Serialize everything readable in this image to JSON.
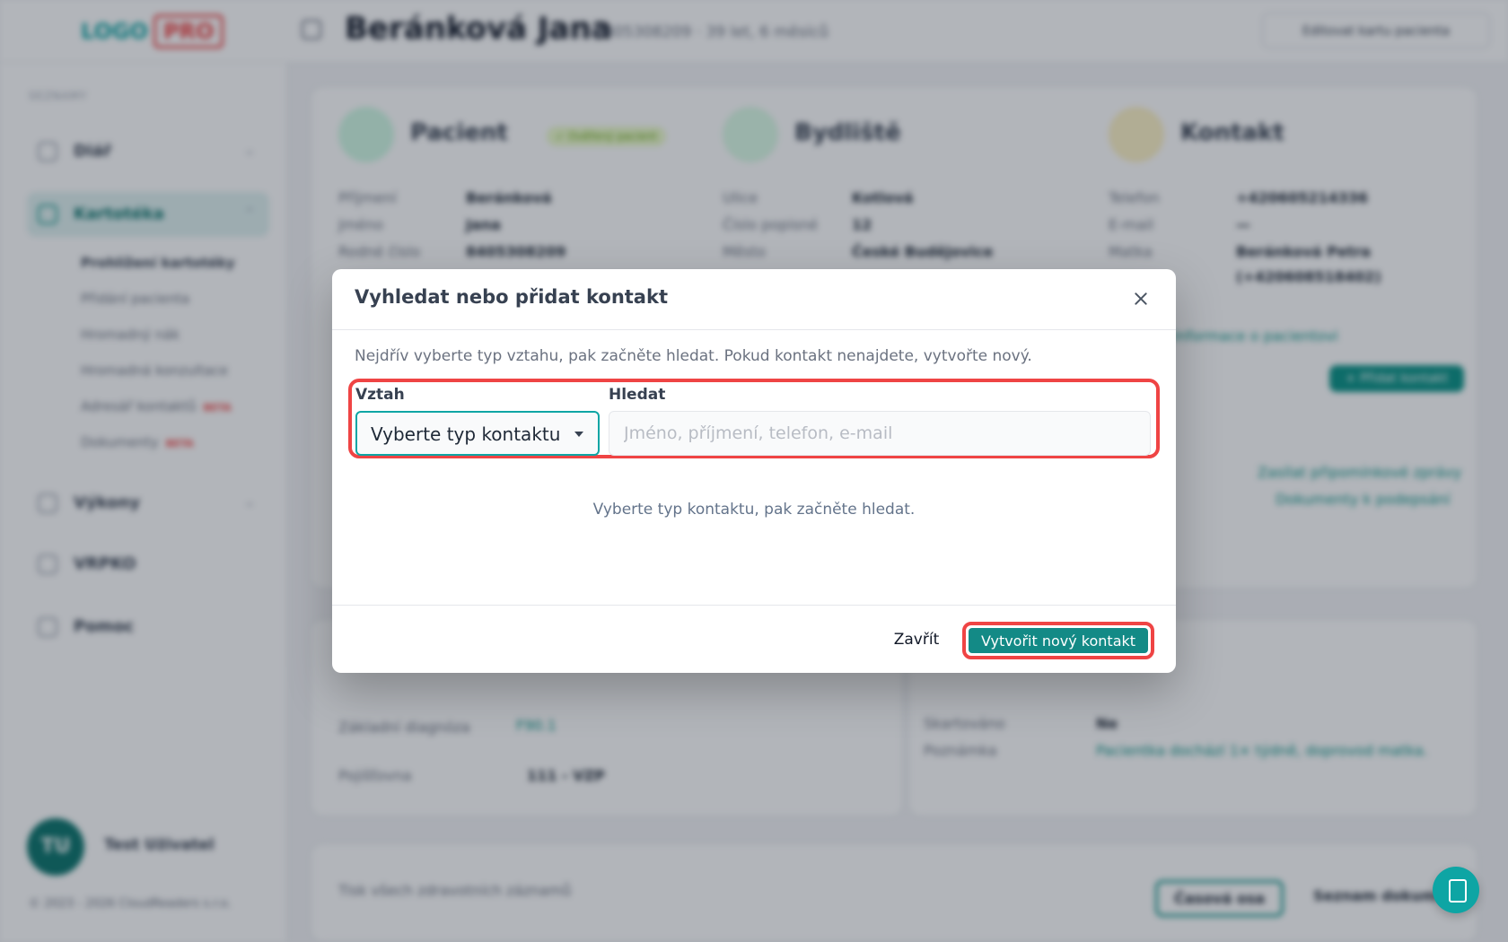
{
  "app": {
    "logo_primary": "LOGO",
    "logo_badge": "PRO",
    "patient_name": "Beránková Jana",
    "patient_id": "8405308209",
    "patient_age": "39 let, 6 měsíců",
    "edit_label": "Editovat kartu pacienta",
    "sidebar": {
      "section": "SEZNAMY",
      "items": [
        {
          "label": "Diář",
          "icon": "calendar-icon"
        },
        {
          "label": "Kartotéka",
          "icon": "folder-icon"
        },
        {
          "label": "Výkony",
          "icon": "clipboard-icon"
        },
        {
          "label": "VRPKO",
          "icon": "doc-icon"
        },
        {
          "label": "Pomoc",
          "icon": "help-icon"
        }
      ],
      "subitems": [
        {
          "label": "Prohlížení kartotéky"
        },
        {
          "label": "Přidání pacienta"
        },
        {
          "label": "Hromadný nák"
        },
        {
          "label": "Hromadná konzultace"
        },
        {
          "label": "Adresář kontaktů",
          "badge": "BETA"
        },
        {
          "label": "Dokumenty",
          "badge": "BETA"
        }
      ],
      "user_initials": "TU",
      "user_name": "Test Uživatel",
      "copyright": "© 2023 - 2026 CloudReaders s.r.o."
    },
    "patient_card": {
      "title": "Pacient",
      "badge": "✓ Ověřený pacient",
      "fields": [
        {
          "label": "Příjmení",
          "value": "Beránková"
        },
        {
          "label": "Jméno",
          "value": "Jana"
        },
        {
          "label": "Rodné číslo",
          "value": "8405308209"
        }
      ]
    },
    "address_card": {
      "title": "Bydliště",
      "fields": [
        {
          "label": "Ulice",
          "value": "Kotlová"
        },
        {
          "label": "Číslo popisné",
          "value": "12"
        },
        {
          "label": "Město",
          "value": "České Budějovice"
        }
      ]
    },
    "contact_card": {
      "title": "Kontakt",
      "fields": [
        {
          "label": "Telefon",
          "value": "+420605214336"
        },
        {
          "label": "E-mail",
          "value": "—"
        },
        {
          "label": "Matka",
          "value": "Beránková Petra"
        }
      ],
      "extra_value": "(+420608518402)",
      "link": "Informace o pacientovi",
      "add_btn": "+ Přidat kontakt",
      "side_links": [
        "Zasílat připomínkové zprávy",
        "Dokumenty k podepsání"
      ]
    },
    "diagnosis": {
      "label": "Základní diagnóza",
      "value": "F90.1",
      "ins_label": "Pojišťovna",
      "ins_value": "111 - VZP"
    },
    "extra": {
      "label1": "Skartováno",
      "value1": "Ne",
      "label2": "Poznámka",
      "value2": "Pacientka dochází 1× týdně, doprovod matka."
    },
    "bottom": {
      "filter": "Tisk všech zdravotních záznamů",
      "btn1": "Časová osa",
      "btn2": "Seznam dokumentů"
    }
  },
  "modal": {
    "title": "Vyhledat nebo přidat kontakt",
    "description": "Nejdřív vyberte typ vztahu, pak začněte hledat. Pokud kontakt nenajdete, vytvořte nový.",
    "relation_label": "Vztah",
    "relation_value": "Vyberte typ kontaktu",
    "search_label": "Hledat",
    "search_placeholder": "Jméno, příjmení, telefon, e-mail",
    "hint": "Vyberte typ kontaktu, pak začněte hledat.",
    "close_label": "Zavřít",
    "create_label": "Vytvořit nový kontakt"
  },
  "colors": {
    "accent": "#0ea5a4",
    "create_button": "#138a86",
    "highlight": "#ef4444"
  }
}
